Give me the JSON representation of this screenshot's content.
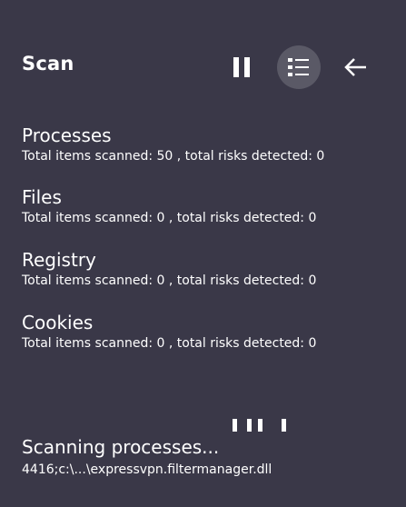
{
  "header": {
    "title": "Scan",
    "pause_icon": "pause-icon",
    "list_icon": "list-icon",
    "back_icon": "arrow-left-icon"
  },
  "sections": [
    {
      "title": "Processes",
      "stats": "Total items scanned: 50 , total risks detected: 0"
    },
    {
      "title": "Files",
      "stats": "Total items scanned: 0 , total risks detected: 0"
    },
    {
      "title": "Registry",
      "stats": "Total items scanned: 0 , total risks detected: 0"
    },
    {
      "title": "Cookies",
      "stats": "Total items scanned: 0 , total risks detected: 0"
    }
  ],
  "status": {
    "title": "Scanning processes...",
    "path": "4416;c:\\...\\expressvpn.filtermanager.dll"
  },
  "colors": {
    "background": "#3a3848",
    "active_button": "#5a5966",
    "text": "#ffffff"
  }
}
